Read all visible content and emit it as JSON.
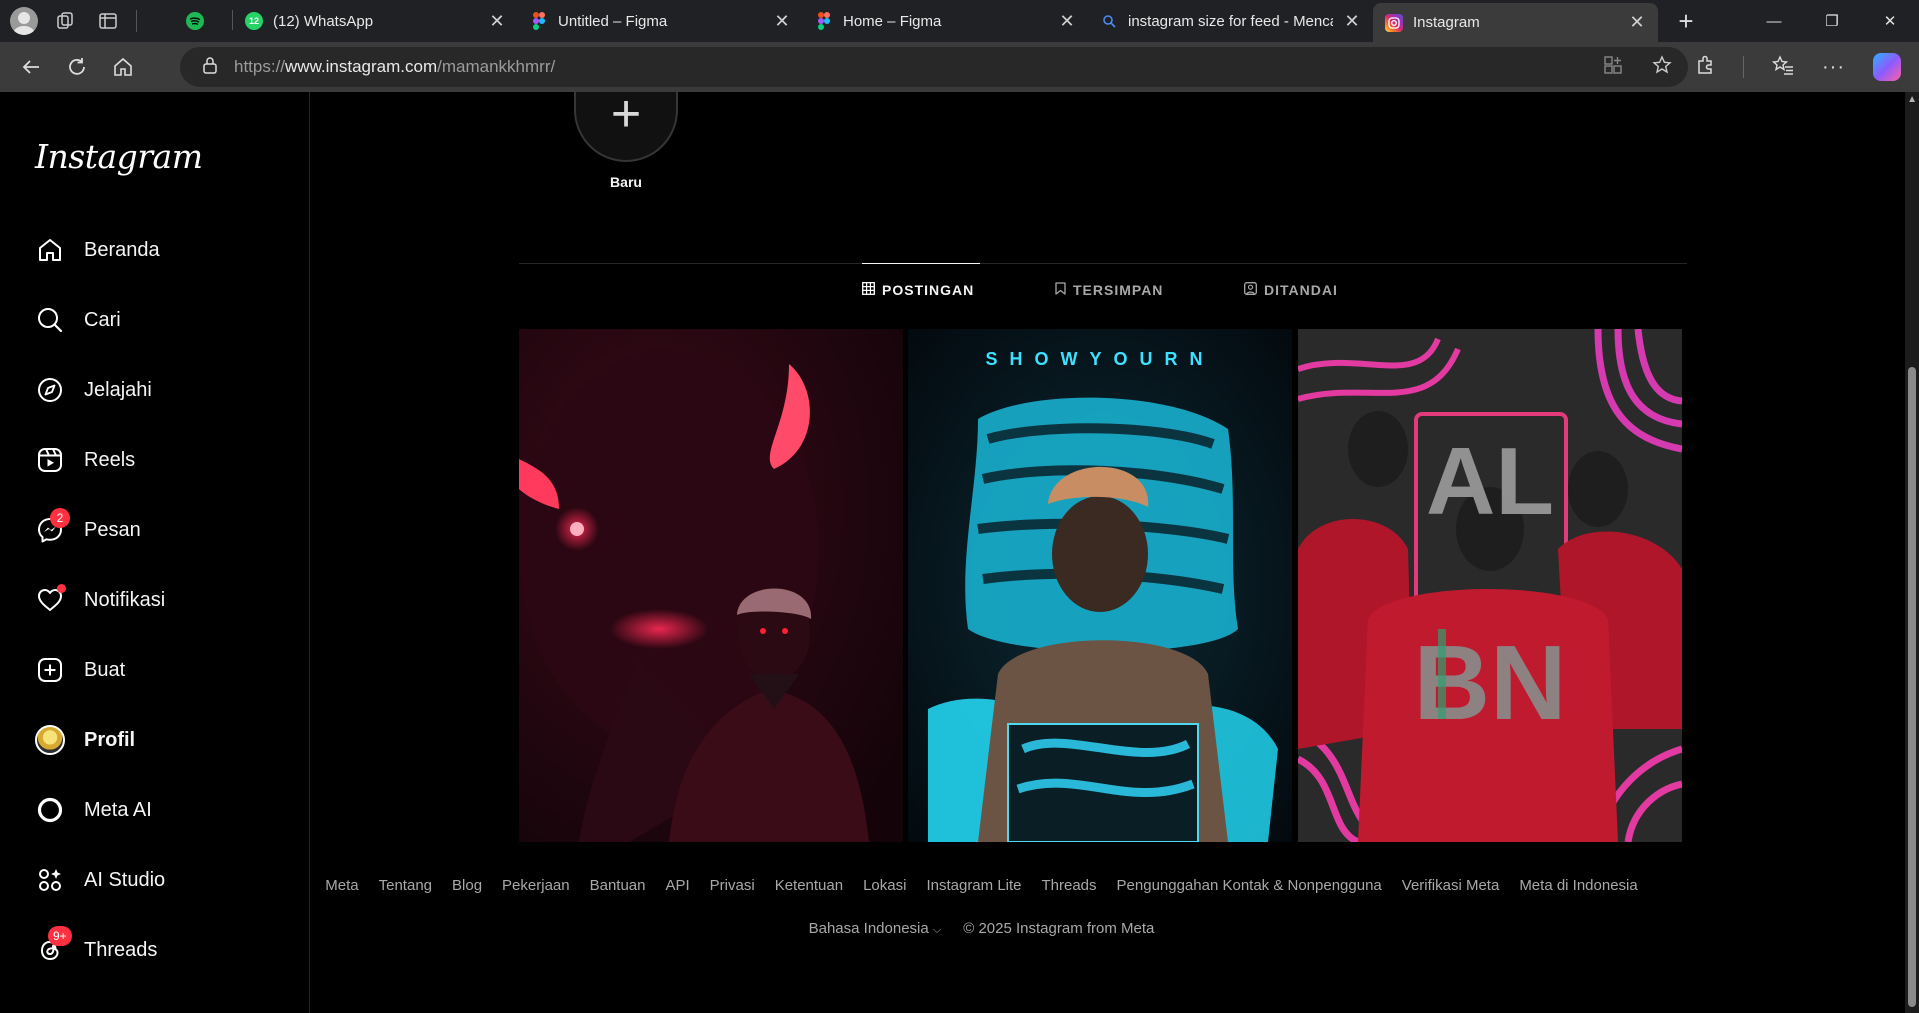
{
  "browser": {
    "tabs": [
      {
        "title": "(12) WhatsApp",
        "favicon": "whatsapp-icon",
        "badge": "12",
        "color": "#25d366"
      },
      {
        "title": "Untitled – Figma",
        "favicon": "figma-icon",
        "color": "#f24e1e"
      },
      {
        "title": "Home – Figma",
        "favicon": "figma-icon",
        "color": "#f24e1e"
      },
      {
        "title": "instagram size for feed - Menca",
        "favicon": "search-icon",
        "color": "#4285f4"
      },
      {
        "title": "Instagram",
        "favicon": "instagram-icon",
        "color": "#e1306c"
      }
    ],
    "url_prefix": "https://",
    "url_domain": "www.instagram.com",
    "url_path": "/mamankkhmrr/"
  },
  "sidebar": {
    "logo": "Instagram",
    "items": [
      {
        "label": "Beranda",
        "icon": "home-icon"
      },
      {
        "label": "Cari",
        "icon": "search-icon"
      },
      {
        "label": "Jelajahi",
        "icon": "compass-icon"
      },
      {
        "label": "Reels",
        "icon": "reels-icon"
      },
      {
        "label": "Pesan",
        "icon": "messenger-icon",
        "badge": "2"
      },
      {
        "label": "Notifikasi",
        "icon": "heart-icon"
      },
      {
        "label": "Buat",
        "icon": "plus-square-icon"
      },
      {
        "label": "Profil",
        "icon": "avatar"
      },
      {
        "label": "Meta AI",
        "icon": "meta-ai-icon"
      },
      {
        "label": "AI Studio",
        "icon": "ai-studio-icon"
      },
      {
        "label": "Threads",
        "icon": "threads-icon",
        "badge": "9+"
      }
    ]
  },
  "highlights": {
    "new_label": "Baru"
  },
  "profile_tabs": [
    {
      "label": "POSTINGAN",
      "icon": "grid-icon",
      "active": true
    },
    {
      "label": "TERSIMPAN",
      "icon": "bookmark-icon",
      "active": false
    },
    {
      "label": "DITANDAI",
      "icon": "tagged-icon",
      "active": false
    }
  ],
  "posts": [
    {
      "overlay_text": ""
    },
    {
      "overlay_text": "SHOWYOURN"
    },
    {
      "overlay_text_1": "AL",
      "overlay_text_2": "BN"
    }
  ],
  "footer": {
    "links": [
      "Meta",
      "Tentang",
      "Blog",
      "Pekerjaan",
      "Bantuan",
      "API",
      "Privasi",
      "Ketentuan",
      "Lokasi",
      "Instagram Lite",
      "Threads",
      "Pengunggahan Kontak & Nonpengguna",
      "Verifikasi Meta",
      "Meta di Indonesia"
    ],
    "language": "Bahasa Indonesia",
    "copyright": "© 2025 Instagram from Meta"
  },
  "colors": {
    "badge": "#ff3040",
    "background": "#000000"
  }
}
